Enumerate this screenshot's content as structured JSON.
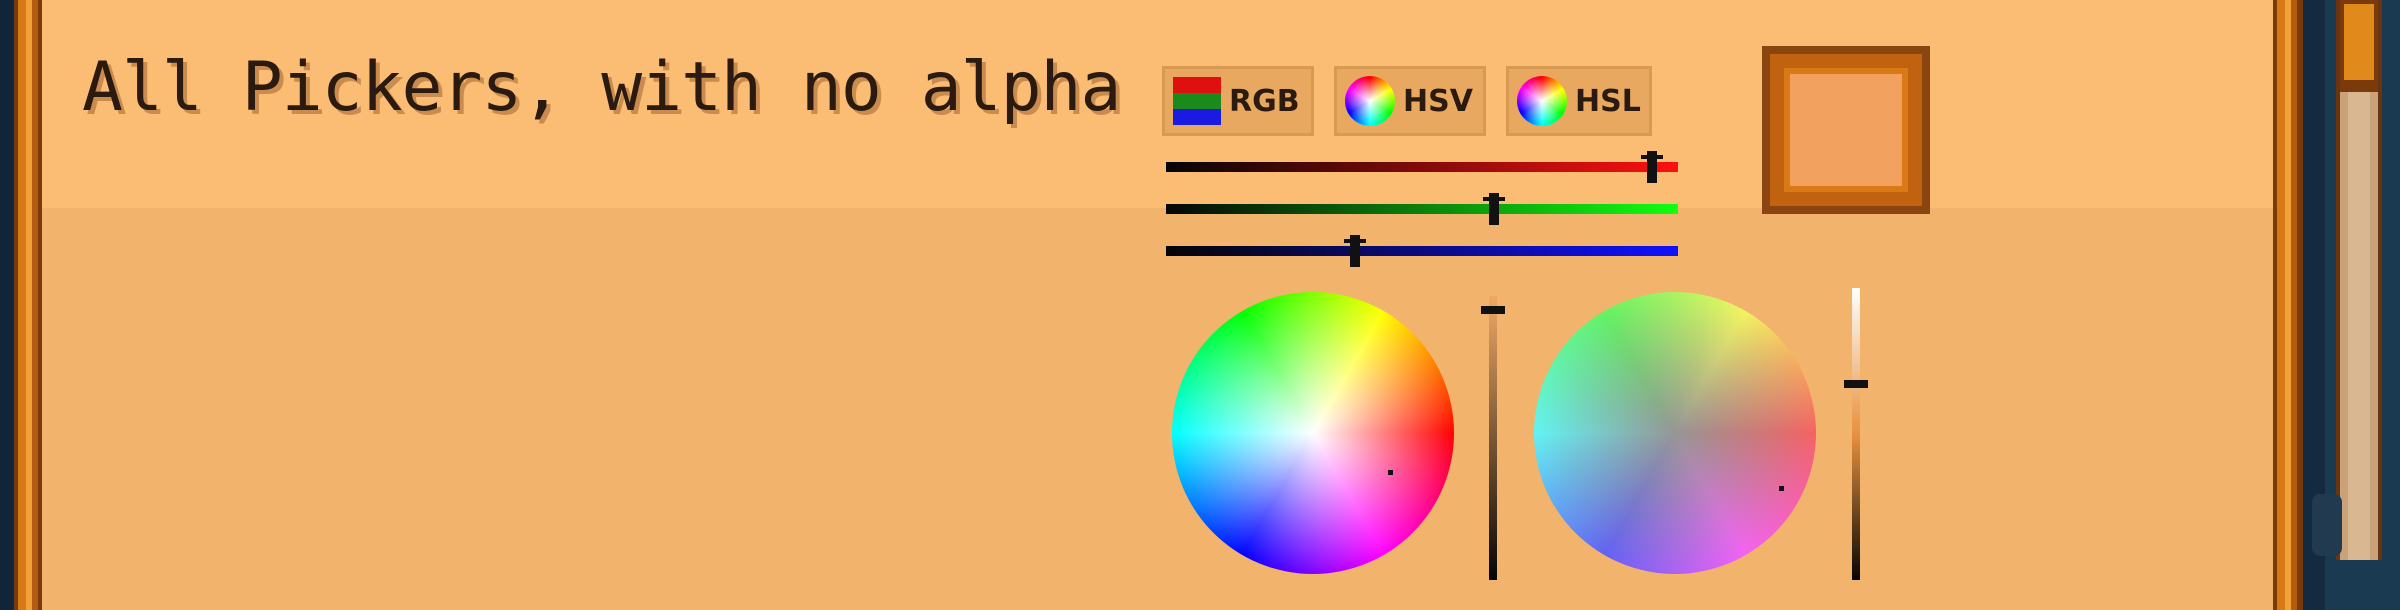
{
  "title": "All Pickers, with no alpha",
  "modes": [
    {
      "label": "RGB",
      "icon": "rgb-swatch-icon"
    },
    {
      "label": "HSV",
      "icon": "color-wheel-icon"
    },
    {
      "label": "HSL",
      "icon": "color-wheel-icon"
    }
  ],
  "selected_color": "#f2a25e",
  "rgb_sliders": {
    "red": 0.95,
    "green": 0.64,
    "blue": 0.37
  },
  "hsv_value_level": 0.95,
  "hsl_lightness_level": 0.67,
  "colors": {
    "panel": "#f2b36c",
    "panel_header": "#fbbd73",
    "wood_border": "#d57a14",
    "text": "#2a1a10"
  }
}
